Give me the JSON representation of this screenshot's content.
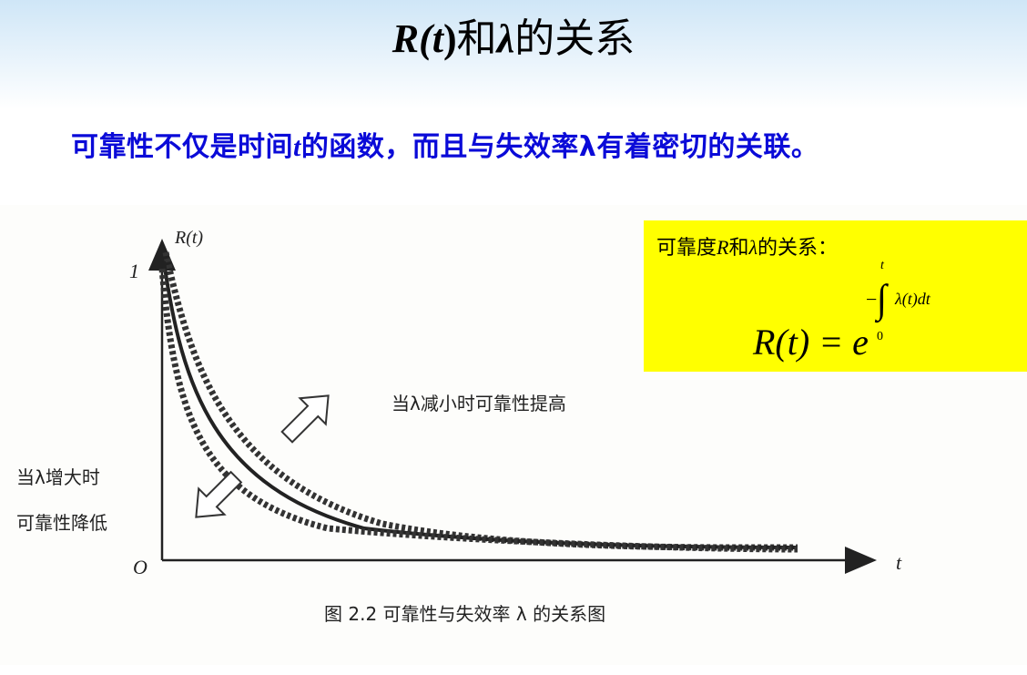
{
  "title": {
    "part1": "R(",
    "part2": "t",
    "part3": ")",
    "part4": "和",
    "part5": "λ",
    "part6": "的关系"
  },
  "subtitle": {
    "before": "可靠性不仅是时间",
    "var": "t",
    "after": "的函数，而且与失效率λ有着密切的关联。"
  },
  "formula": {
    "label_before": "可靠度",
    "label_var": "R",
    "label_mid": "和",
    "label_lambda": "λ",
    "label_after": "的关系：",
    "lhs": "R(t) = e",
    "minus": "−",
    "integral": "∫",
    "upper_limit": "t",
    "lower_limit": "0",
    "integrand": "λ(t)dt"
  },
  "figure": {
    "y_axis_label": "R(t)",
    "y_tick_label": "1",
    "x_axis_label": "t",
    "origin_label": "O",
    "annotation_decrease": "当λ减小时可靠性提高",
    "annotation_increase_line1": "当λ增大时",
    "annotation_increase_line2": "可靠性降低",
    "caption": "图 2.2   可靠性与失效率 λ 的关系图"
  }
}
